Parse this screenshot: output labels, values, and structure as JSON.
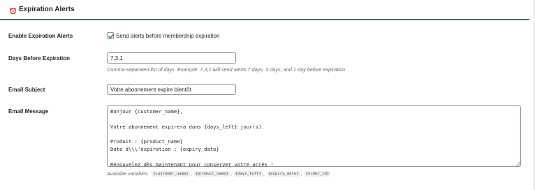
{
  "header": {
    "title": "Expiration Alerts",
    "icon": "alarm-clock-icon",
    "icon_color": "#d63638",
    "accent_color": "#2271b1"
  },
  "enable": {
    "label": "Enable Expiration Alerts",
    "checkbox_label": "Send alerts before membership expiration",
    "checked": true
  },
  "days": {
    "label": "Days Before Expiration",
    "value": "7,3,1",
    "description": "Comma-separated list of days. Example: 7,3,1 will send alerts 7 days, 3 days, and 1 day before expiration."
  },
  "subject": {
    "label": "Email Subject",
    "value": "Votre abonnement expire bientôt"
  },
  "message": {
    "label": "Email Message",
    "value": "Bonjour {customer_name},\n\nVotre abonnement expirera dans {days_left} jour(s).\n\nProduit : {product_name}\nDate d\\\\\\'expiration : {expiry_date}\n\nRenouvelez dès maintenant pour conserver votre accès !",
    "available_label": "Available variables:",
    "variables": [
      "{customer_name}",
      "{product_name}",
      "{days_left}",
      "{expiry_date}",
      "{order_id}"
    ],
    "separator": ","
  }
}
